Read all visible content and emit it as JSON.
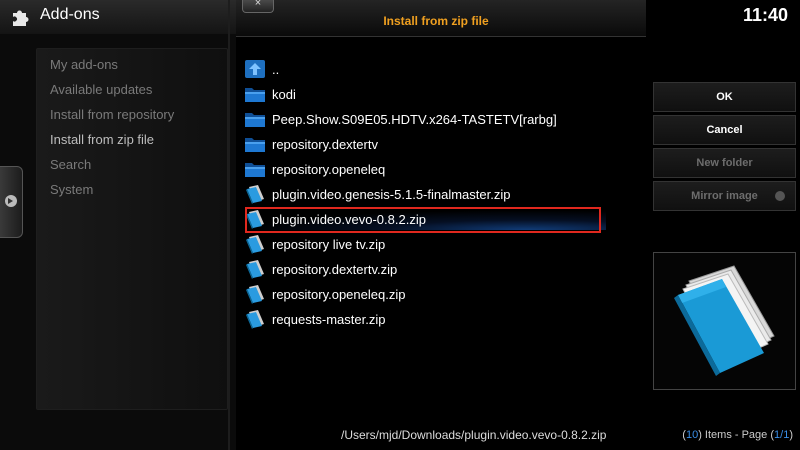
{
  "header": {
    "title": "Add-ons"
  },
  "clock": "11:40",
  "left_menu": {
    "items": [
      {
        "label": "My add-ons",
        "active": false
      },
      {
        "label": "Available updates",
        "active": false
      },
      {
        "label": "Install from repository",
        "active": false
      },
      {
        "label": "Install from zip file",
        "active": true
      },
      {
        "label": "Search",
        "active": false
      },
      {
        "label": "System",
        "active": false
      }
    ]
  },
  "dialog": {
    "title": "Install from zip file",
    "close_label": "×",
    "files": [
      {
        "name": "..",
        "icon": "up-folder-icon",
        "selected": false
      },
      {
        "name": "kodi",
        "icon": "folder-icon",
        "selected": false
      },
      {
        "name": "Peep.Show.S09E05.HDTV.x264-TASTETV[rarbg]",
        "icon": "folder-icon",
        "selected": false
      },
      {
        "name": "repository.dextertv",
        "icon": "folder-icon",
        "selected": false
      },
      {
        "name": "repository.openeleq",
        "icon": "folder-icon",
        "selected": false
      },
      {
        "name": "plugin.video.genesis-5.1.5-finalmaster.zip",
        "icon": "zip-file-icon",
        "selected": false
      },
      {
        "name": "plugin.video.vevo-0.8.2.zip",
        "icon": "zip-file-icon",
        "selected": true
      },
      {
        "name": "repository live tv.zip",
        "icon": "zip-file-icon",
        "selected": false
      },
      {
        "name": "repository.dextertv.zip",
        "icon": "zip-file-icon",
        "selected": false
      },
      {
        "name": "repository.openeleq.zip",
        "icon": "zip-file-icon",
        "selected": false
      },
      {
        "name": "requests-master.zip",
        "icon": "zip-file-icon",
        "selected": false
      }
    ],
    "buttons": {
      "ok": "OK",
      "cancel": "Cancel",
      "new_folder": "New folder",
      "mirror_image": "Mirror image"
    },
    "path": "/Users/mjd/Downloads/plugin.video.vevo-0.8.2.zip",
    "page_info": {
      "count_open": "(",
      "count": "10",
      "count_close": ")",
      "suffix": " Items - Page ",
      "page_open": "(",
      "page": "1/1",
      "page_close": ")"
    }
  },
  "colors": {
    "accent": "#f0a020",
    "selection_box": "#e0281e",
    "folder_blue": "#1e6fbf",
    "count_blue": "#3a8ee6"
  }
}
